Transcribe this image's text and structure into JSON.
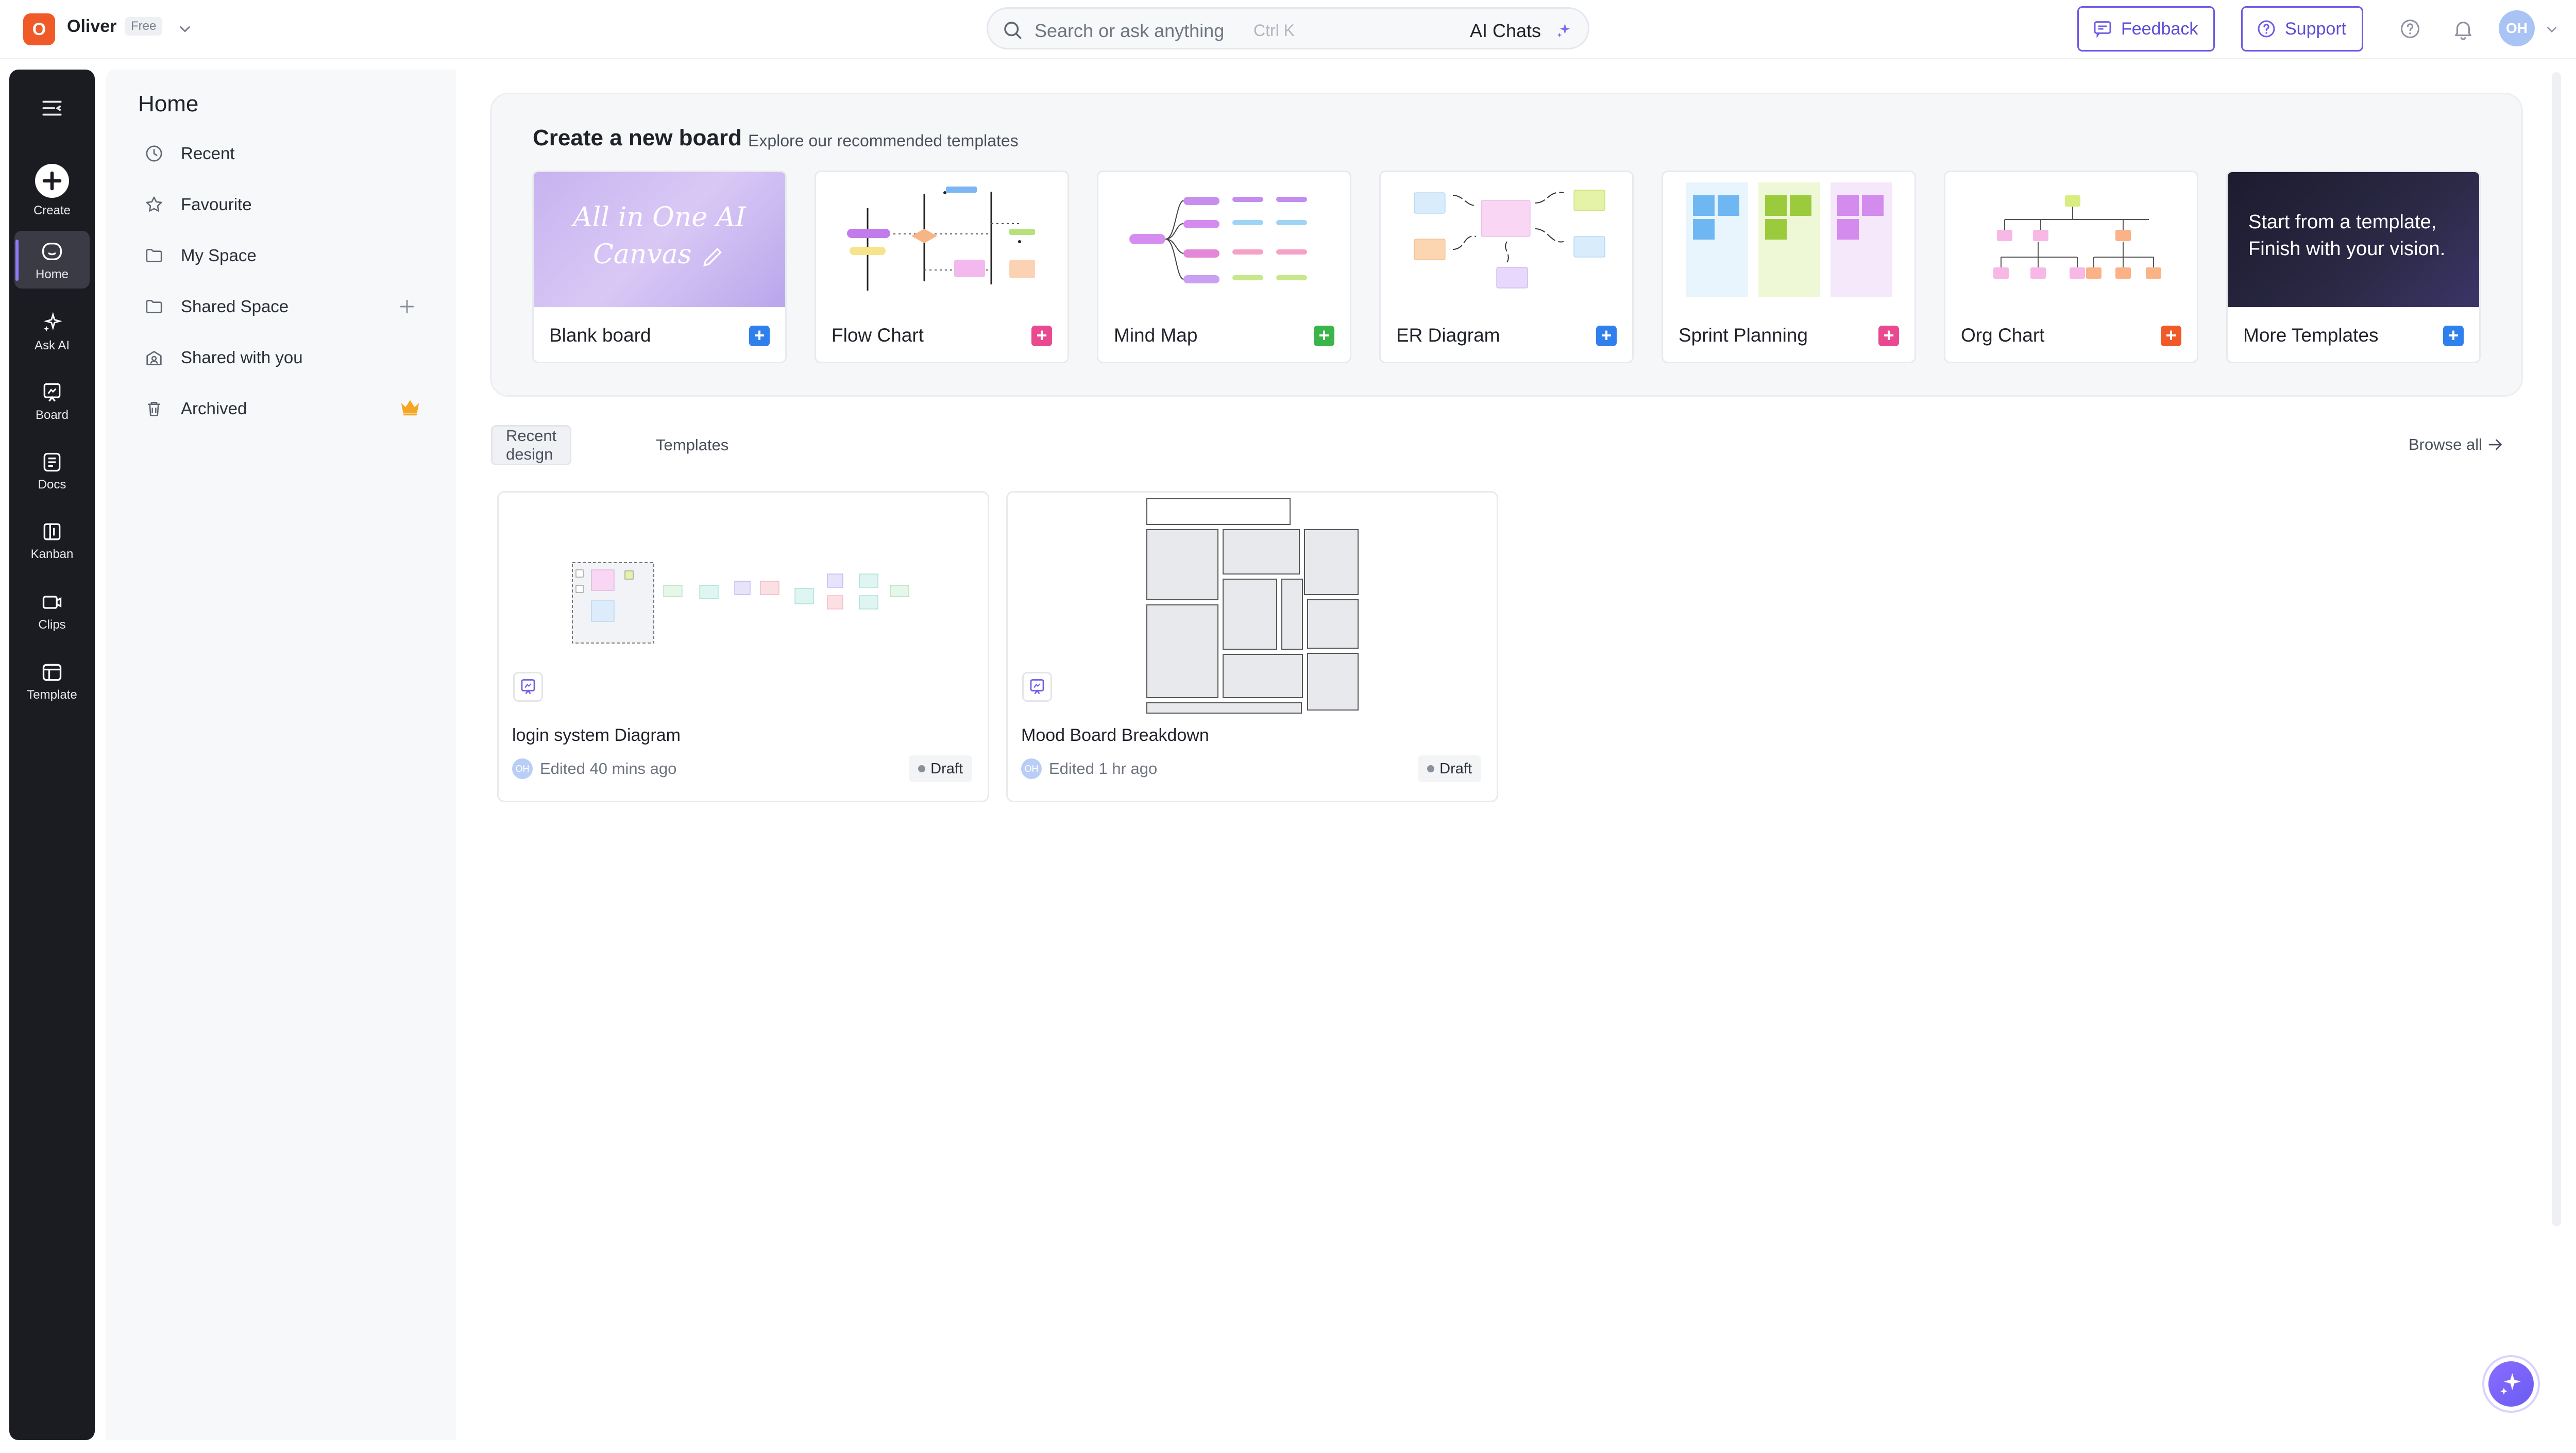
{
  "workspace": {
    "initial": "O",
    "name": "Oliver",
    "plan": "Free"
  },
  "search": {
    "placeholder": "Search or ask anything",
    "shortcut": "Ctrl K",
    "ai_label": "AI Chats"
  },
  "header": {
    "feedback": "Feedback",
    "support": "Support",
    "avatar": "OH"
  },
  "rail": {
    "items": [
      {
        "label": "Create",
        "icon": "plus-circle-icon"
      },
      {
        "label": "Home",
        "icon": "home-icon"
      },
      {
        "label": "Ask AI",
        "icon": "sparkle-icon"
      },
      {
        "label": "Board",
        "icon": "board-icon"
      },
      {
        "label": "Docs",
        "icon": "docs-icon"
      },
      {
        "label": "Kanban",
        "icon": "kanban-icon"
      },
      {
        "label": "Clips",
        "icon": "clips-icon"
      },
      {
        "label": "Template",
        "icon": "template-icon"
      }
    ]
  },
  "sidebar": {
    "title": "Home",
    "items": [
      {
        "label": "Recent",
        "icon": "clock-icon"
      },
      {
        "label": "Favourite",
        "icon": "star-icon"
      },
      {
        "label": "My Space",
        "icon": "folder-icon"
      },
      {
        "label": "Shared Space",
        "icon": "folder-icon"
      },
      {
        "label": "Shared with you",
        "icon": "shared-icon"
      },
      {
        "label": "Archived",
        "icon": "trash-icon"
      }
    ]
  },
  "create": {
    "title": "Create a new board",
    "subtitle": "Explore our recommended templates",
    "blank_thumb_line1": "All in One AI",
    "blank_thumb_line2": "Canvas",
    "more_thumb_line1": "Start from a template,",
    "more_thumb_line2": "Finish with your vision.",
    "templates": [
      {
        "label": "Blank board",
        "accent": "#2f80ed"
      },
      {
        "label": "Flow Chart",
        "accent": "#e94a8f"
      },
      {
        "label": "Mind Map",
        "accent": "#3bb54a"
      },
      {
        "label": "ER Diagram",
        "accent": "#2f80ed"
      },
      {
        "label": "Sprint Planning",
        "accent": "#e94a8f"
      },
      {
        "label": "Org Chart",
        "accent": "#f05a28"
      },
      {
        "label": "More Templates",
        "accent": "#2f80ed"
      }
    ]
  },
  "tabs": {
    "recent": "Recent design",
    "templates": "Templates",
    "browse_all": "Browse all"
  },
  "designs": [
    {
      "name": "login system Diagram",
      "edited": "Edited 40 mins ago",
      "status": "Draft",
      "avatar": "OH"
    },
    {
      "name": "Mood Board Breakdown",
      "edited": "Edited 1 hr ago",
      "status": "Draft",
      "avatar": "OH"
    }
  ]
}
